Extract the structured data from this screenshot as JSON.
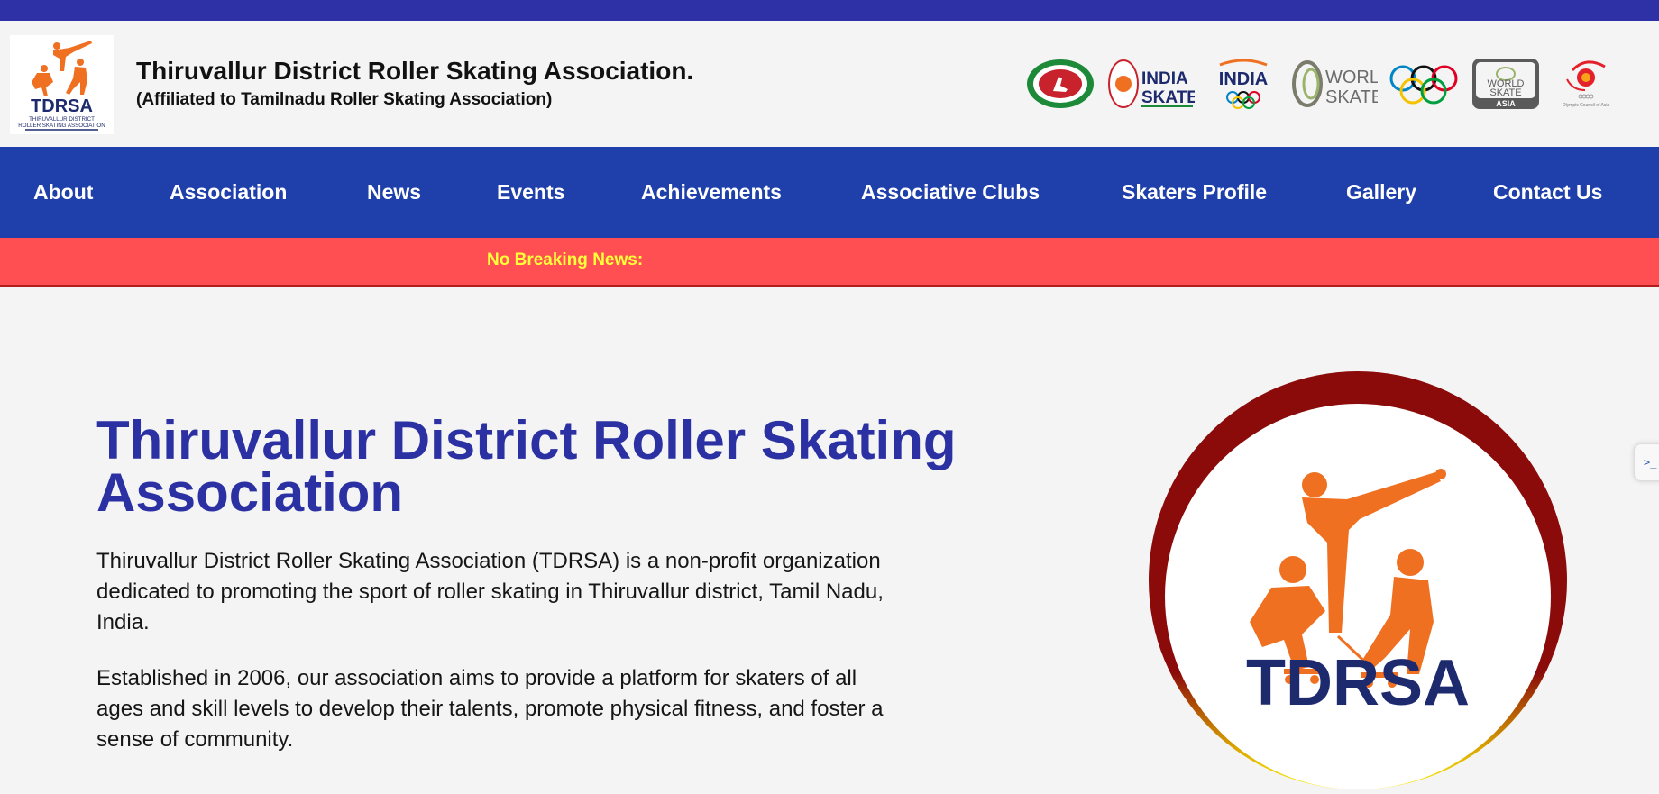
{
  "header": {
    "logo_alt_text": "TDRSA",
    "logo_caption": "THIRUVALLUR DISTRICT ROLLER SKATING ASSOCIATION",
    "title": "Thiruvallur District Roller Skating Association.",
    "subtitle": "(Affiliated to Tamilnadu Roller Skating Association)",
    "partners": [
      {
        "name": "Sports Development Authority of Tamil Nadu",
        "icon": "sdat-seal-icon"
      },
      {
        "name": "India Skate",
        "icon": "india-skate-logo",
        "text_top": "INDIA",
        "text_bottom": "SKATE"
      },
      {
        "name": "India Olympic",
        "icon": "india-olympic-logo",
        "text": "INDIA"
      },
      {
        "name": "World Skate",
        "icon": "world-skate-logo",
        "text_top": "WORLD",
        "text_bottom": "SKATE"
      },
      {
        "name": "Olympic Rings",
        "icon": "olympic-rings-icon"
      },
      {
        "name": "World Skate Asia",
        "icon": "world-skate-asia-logo",
        "text_top": "WORLD",
        "text_mid": "SKATE",
        "text_bottom": "ASIA"
      },
      {
        "name": "Olympic Council of Asia",
        "icon": "oca-logo",
        "text": "Olympic Council of Asia"
      }
    ]
  },
  "nav": {
    "items": [
      {
        "label": "About"
      },
      {
        "label": "Association"
      },
      {
        "label": "News"
      },
      {
        "label": "Events"
      },
      {
        "label": "Achievements"
      },
      {
        "label": "Associative Clubs"
      },
      {
        "label": "Skaters Profile"
      },
      {
        "label": "Gallery"
      },
      {
        "label": "Contact Us"
      }
    ]
  },
  "ticker": {
    "text": "No Breaking News:"
  },
  "hero": {
    "title": "Thiruvallur District Roller Skating Association",
    "paragraphs": [
      "Thiruvallur District Roller Skating Association (TDRSA) is a non-profit organization dedicated to promoting the sport of roller skating in Thiruvallur district, Tamil Nadu, India.",
      "Established in 2006, our association aims to provide a platform for skaters of all ages and skill levels to develop their talents, promote physical fitness, and foster a sense of community."
    ],
    "logo_text": "TDRSA"
  },
  "side_tab": {
    "label": ">_"
  },
  "colors": {
    "top_strip": "#2e31a6",
    "nav_bg": "#1f40aa",
    "ticker_bg": "#ff4f52",
    "ticker_text": "#ffff3a",
    "hero_title": "#2b30a3",
    "brand_orange": "#f07021",
    "brand_navy": "#1e2a6e",
    "ring_maroon": "#8b0a0a"
  }
}
